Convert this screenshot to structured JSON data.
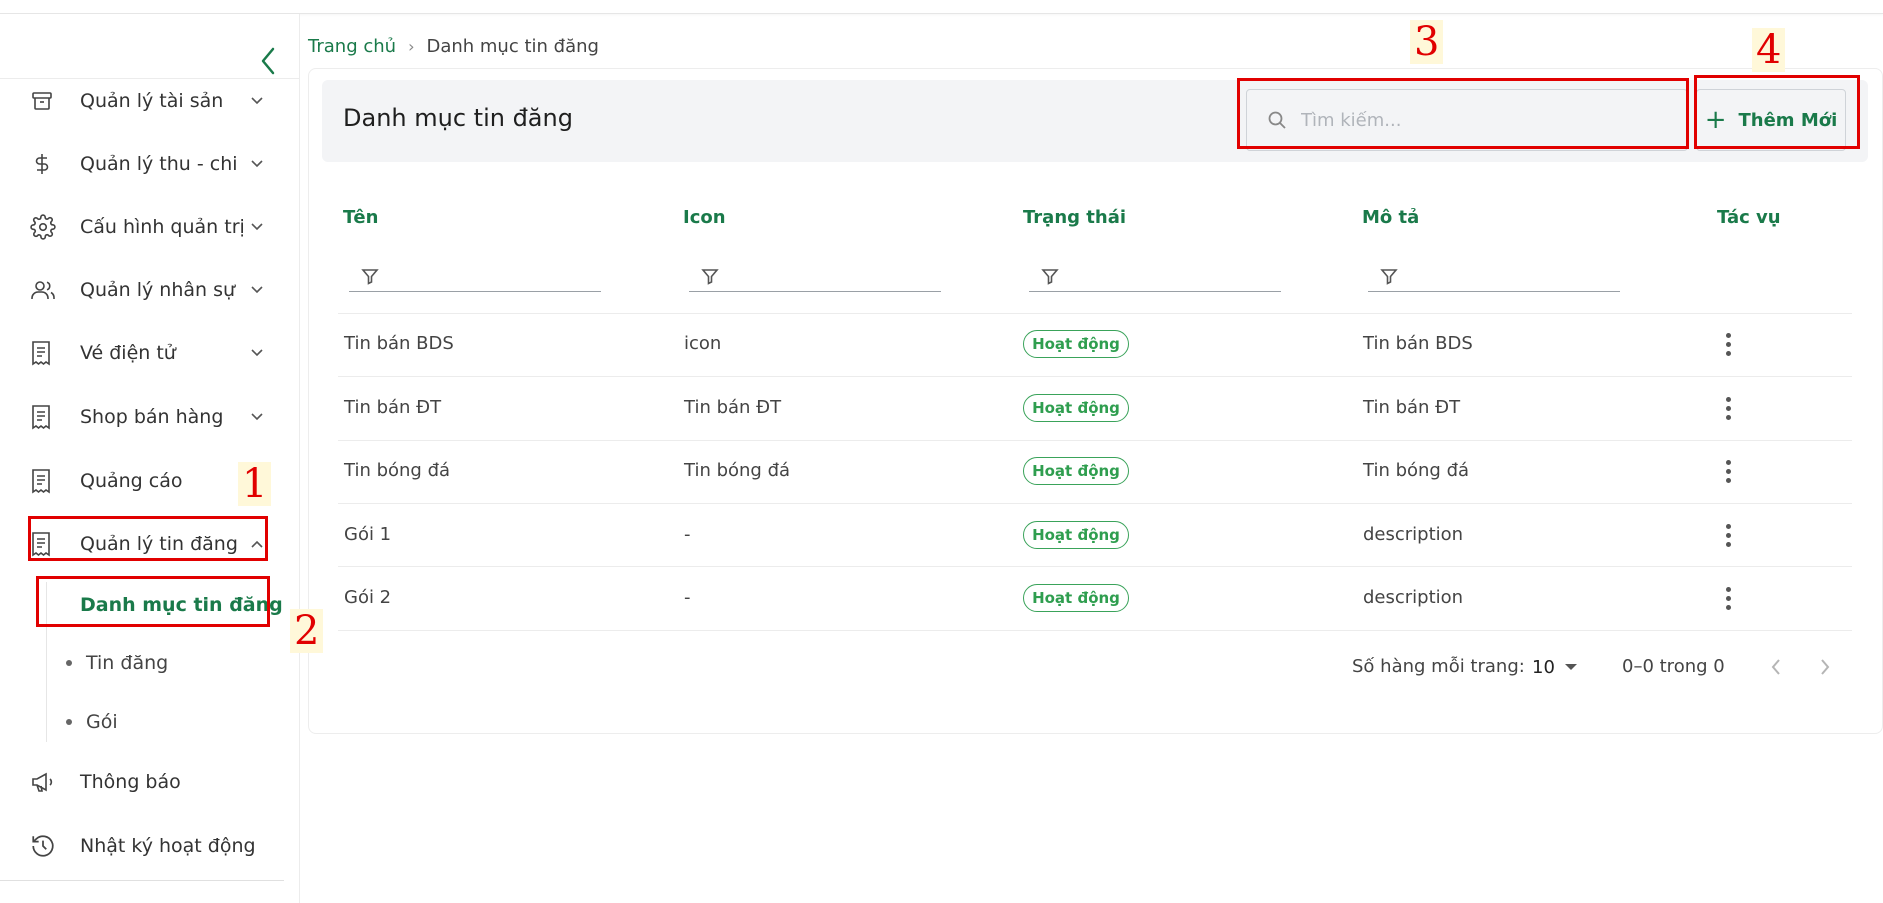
{
  "sidebar": {
    "items": [
      {
        "label": "Quản lý tài sản",
        "icon": "archive-icon",
        "chevron": "down"
      },
      {
        "label": "Quản lý thu - chi",
        "icon": "dollar-icon",
        "chevron": "down"
      },
      {
        "label": "Cấu hình quản trị",
        "icon": "gear-icon",
        "chevron": "down"
      },
      {
        "label": "Quản lý nhân sự",
        "icon": "users-icon",
        "chevron": "down"
      },
      {
        "label": "Vé điện tử",
        "icon": "receipt-icon",
        "chevron": "down"
      },
      {
        "label": "Shop bán hàng",
        "icon": "receipt-icon",
        "chevron": "down"
      },
      {
        "label": "Quảng cáo",
        "icon": "receipt-icon",
        "chevron": "none"
      },
      {
        "label": "Quản lý tin đăng",
        "icon": "receipt-icon",
        "chevron": "up"
      },
      {
        "label": "Thông báo",
        "icon": "megaphone-icon",
        "chevron": "none"
      },
      {
        "label": "Nhật ký hoạt động",
        "icon": "history-icon",
        "chevron": "none"
      }
    ],
    "sub_items": [
      {
        "label": "Danh mục tin đăng",
        "active": true
      },
      {
        "label": "Tin đăng",
        "active": false
      },
      {
        "label": "Gói",
        "active": false
      }
    ]
  },
  "annotations": [
    "1",
    "2",
    "3",
    "4"
  ],
  "breadcrumb": {
    "home": "Trang chủ",
    "separator": "›",
    "current": "Danh mục tin đăng"
  },
  "header": {
    "title": "Danh mục tin đăng",
    "search_placeholder": "Tìm kiếm...",
    "add_label": "Thêm Mới"
  },
  "table": {
    "columns": [
      "Tên",
      "Icon",
      "Trạng thái",
      "Mô tả",
      "Tác vụ"
    ],
    "rows": [
      {
        "name": "Tin bán BDS",
        "icon": "icon",
        "status": "Hoạt động",
        "description": "Tin bán BDS"
      },
      {
        "name": "Tin bán ĐT",
        "icon": "Tin bán ĐT",
        "status": "Hoạt động",
        "description": "Tin bán ĐT"
      },
      {
        "name": "Tin bóng đá",
        "icon": "Tin bóng đá",
        "status": "Hoạt động",
        "description": "Tin bóng đá"
      },
      {
        "name": "Gói 1",
        "icon": "-",
        "status": "Hoạt động",
        "description": "description"
      },
      {
        "name": "Gói 2",
        "icon": "-",
        "status": "Hoạt động",
        "description": "description"
      }
    ]
  },
  "pagination": {
    "rows_per_page_label": "Số hàng mỗi trang:",
    "rows_per_page": "10",
    "range": "0–0 trong 0"
  },
  "colors": {
    "accent": "#1a7a4a",
    "annotation": "#e10000",
    "badge": "#2f9e4f"
  }
}
